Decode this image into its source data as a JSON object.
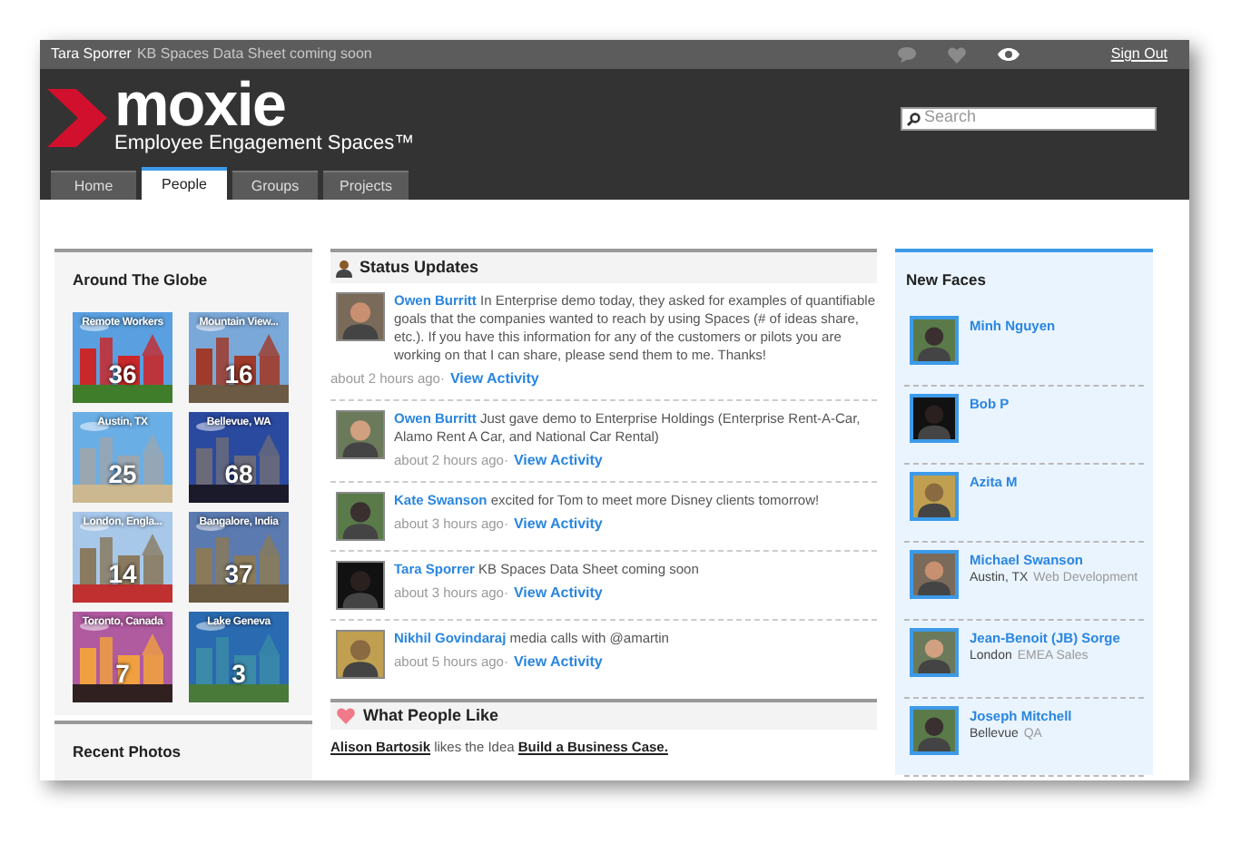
{
  "top_bar": {
    "user": "Tara Sporrer",
    "message": "KB Spaces Data Sheet coming soon",
    "sign_out": "Sign Out"
  },
  "header": {
    "logo": "moxie",
    "tagline": "Employee Engagement Spaces™",
    "search": {
      "placeholder": "Search"
    }
  },
  "tabs": [
    {
      "label": "Home",
      "selected": false
    },
    {
      "label": "People",
      "selected": true
    },
    {
      "label": "Groups",
      "selected": false
    },
    {
      "label": "Projects",
      "selected": false
    }
  ],
  "around_the_globe": {
    "title": "Around The Globe",
    "tiles": [
      {
        "label": "Remote Workers",
        "count": "36"
      },
      {
        "label": "Mountain View...",
        "count": "16"
      },
      {
        "label": "Austin, TX",
        "count": "25"
      },
      {
        "label": "Bellevue, WA",
        "count": "68"
      },
      {
        "label": "London, Engla...",
        "count": "14"
      },
      {
        "label": "Bangalore, India",
        "count": "37"
      },
      {
        "label": "Toronto, Canada",
        "count": "7"
      },
      {
        "label": "Lake Geneva",
        "count": "3"
      }
    ]
  },
  "recent_photos": {
    "title": "Recent Photos"
  },
  "status_updates": {
    "title": "Status Updates",
    "items": [
      {
        "name": "Owen Burritt",
        "text": "In Enterprise demo today, they asked for examples of quantifiable goals that the companies wanted to reach by using Spaces (# of ideas share, etc.). If you have this information for any of the customers or pilots you are working on that I can share, please send them to me. Thanks!",
        "time": "about 2 hours ago·",
        "link": "View Activity"
      },
      {
        "name": "Owen Burritt",
        "text": "Just gave demo to Enterprise Holdings (Enterprise Rent-A-Car, Alamo Rent A Car, and National Car Rental)",
        "time": "about 2 hours ago·",
        "link": "View Activity"
      },
      {
        "name": "Kate Swanson",
        "text": "excited for Tom to meet more Disney clients tomorrow!",
        "time": "about 3 hours ago·",
        "link": "View Activity"
      },
      {
        "name": "Tara Sporrer",
        "text": "KB Spaces Data Sheet coming soon",
        "time": "about 3 hours ago·",
        "link": "View Activity"
      },
      {
        "name": "Nikhil Govindaraj",
        "text": "media calls with @amartin",
        "time": "about 5 hours ago·",
        "link": "View Activity"
      }
    ]
  },
  "what_people_like": {
    "title": "What People Like",
    "items": [
      {
        "user": "Alison Bartosik",
        "text": "likes the Idea",
        "idea": "Build a Business Case."
      }
    ]
  },
  "new_faces": {
    "title": "New Faces",
    "people": [
      {
        "name": "Minh Nguyen"
      },
      {
        "name": "Bob P"
      },
      {
        "name": "Azita M"
      },
      {
        "name": "Michael Swanson",
        "location": "Austin, TX",
        "role": "Web Development"
      },
      {
        "name": "Jean-Benoit (JB) Sorge",
        "location": "London",
        "role": "EMEA Sales"
      },
      {
        "name": "Joseph Mitchell",
        "location": "Bellevue",
        "role": "QA"
      }
    ]
  }
}
